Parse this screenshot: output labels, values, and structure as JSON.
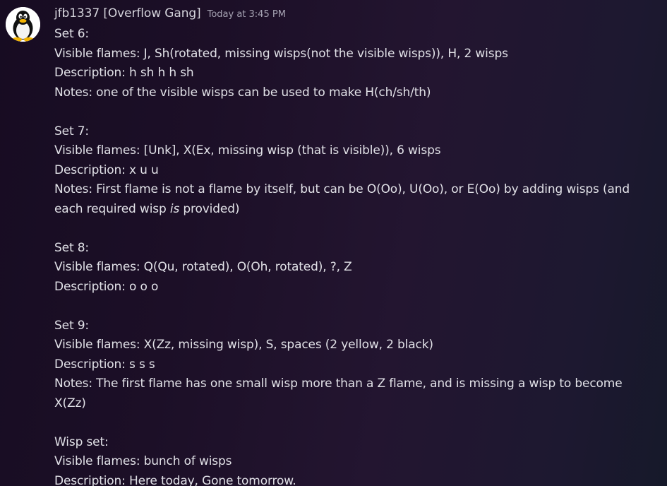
{
  "message": {
    "author": "jfb1337 [Overflow Gang]",
    "timestamp": "Today at 3:45 PM",
    "avatar_icon": "tux-penguin-icon",
    "lines": {
      "set6_title": "Set 6:",
      "set6_flames": "Visible flames: J, Sh(rotated, missing wisps(not the visible wisps)), H, 2 wisps",
      "set6_desc": "Description: h sh h h sh",
      "set6_notes": "Notes: one of the visible wisps can be used to make H(ch/sh/th)",
      "set7_title": "Set 7:",
      "set7_flames": "Visible flames: [Unk], X(Ex, missing wisp (that is visible)), 6 wisps",
      "set7_desc": "Description: x u u",
      "set7_notes_a": "Notes: First flame is not a flame by itself, but can be O(Oo), U(Oo), or E(Oo) by adding wisps (and each required wisp ",
      "set7_notes_em": "is",
      "set7_notes_b": " provided)",
      "set8_title": "Set 8:",
      "set8_flames": "Visible flames: Q(Qu, rotated), O(Oh, rotated), ?, Z",
      "set8_desc": "Description: o o o",
      "set9_title": "Set 9:",
      "set9_flames": "Visible flames: X(Zz, missing wisp), S, spaces (2 yellow, 2 black)",
      "set9_desc": "Description: s s s",
      "set9_notes": "Notes: The first flame has one small wisp more than a Z flame, and is missing a wisp to become X(Zz)",
      "wisp_title": "Wisp set:",
      "wisp_flames": "Visible flames: bunch of wisps",
      "wisp_desc": "Description:  Here today, Gone tomorrow."
    }
  },
  "colors": {
    "background_start": "#170c22",
    "background_end": "#16192a",
    "text": "#e1e1e7",
    "username": "#d5d4dc",
    "timestamp": "#a7a4b4"
  }
}
